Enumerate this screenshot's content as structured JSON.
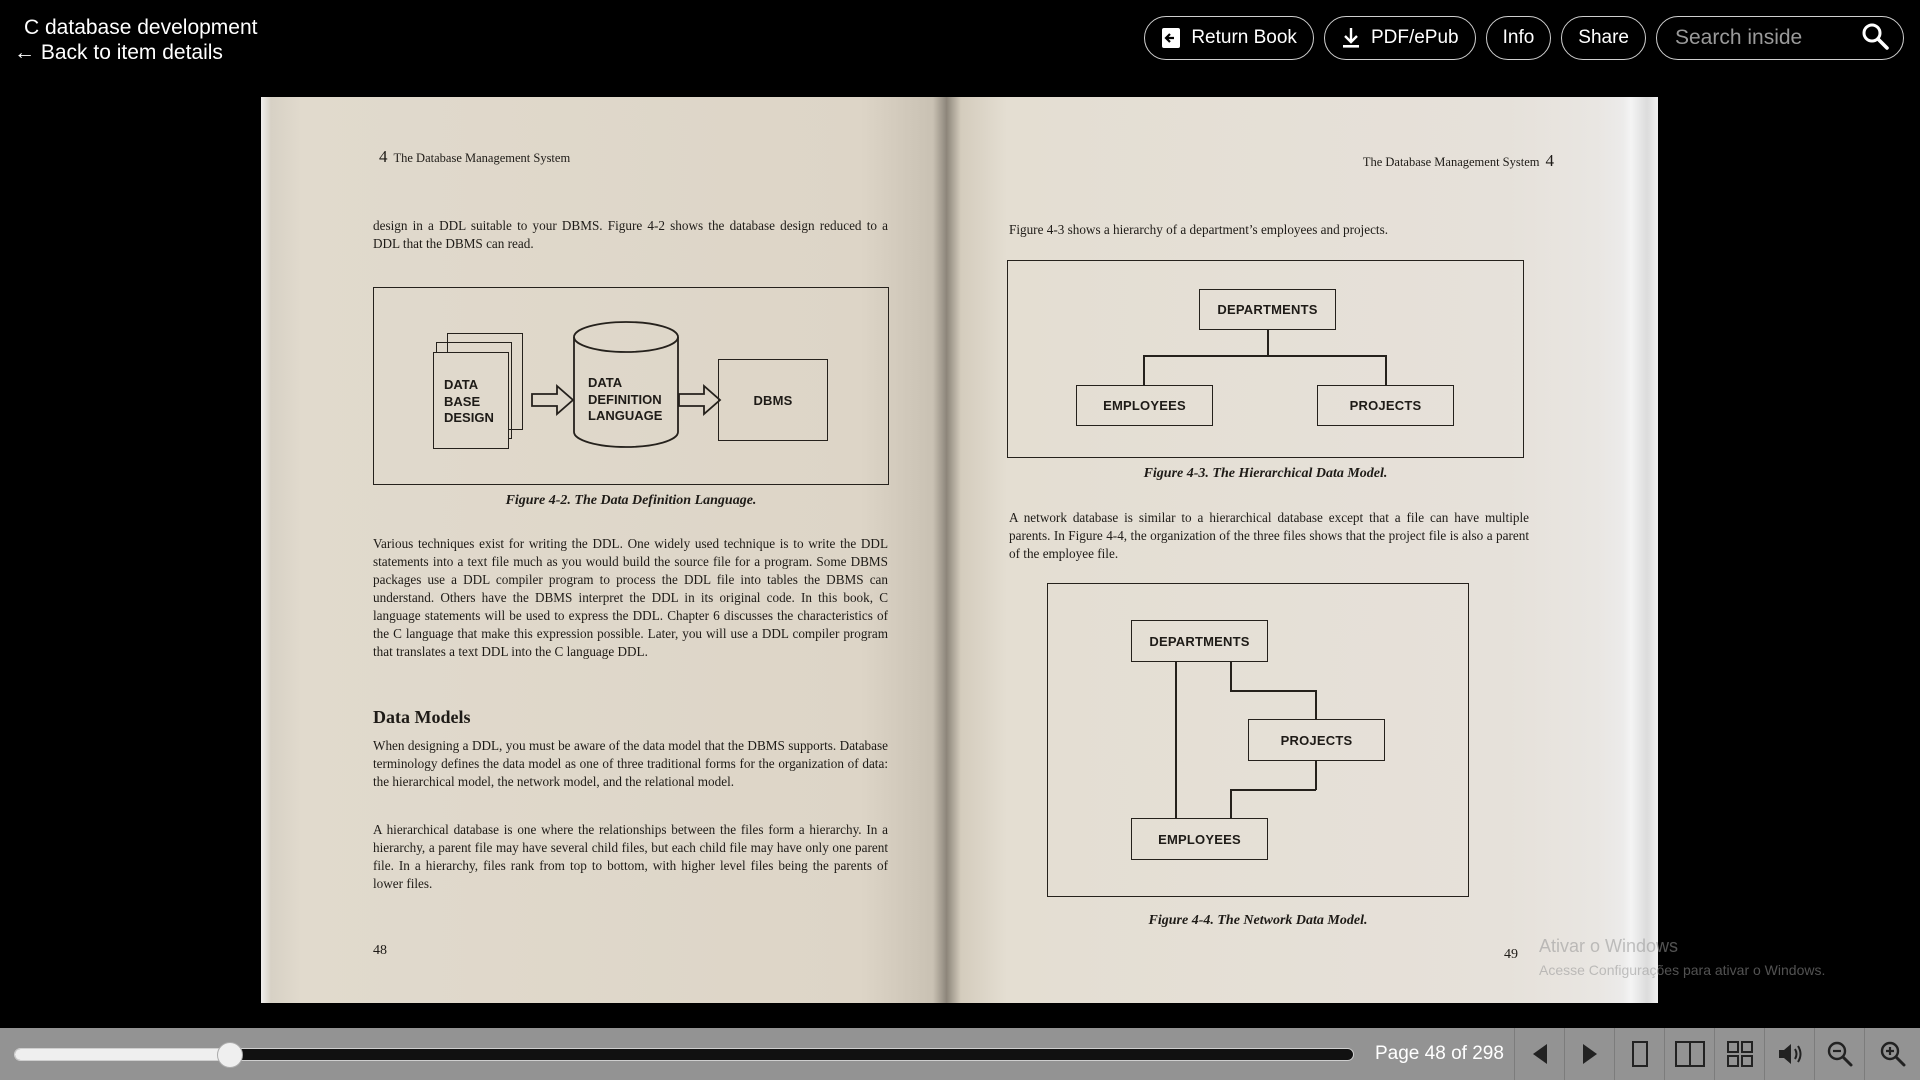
{
  "header": {
    "book_title": "C database development",
    "back_label": "← Back to item details",
    "buttons": {
      "return_book": "Return Book",
      "download": "PDF/ePub",
      "info": "Info",
      "share": "Share"
    },
    "search": {
      "placeholder": "Search inside",
      "value": ""
    }
  },
  "left_page": {
    "running_head_number": "4",
    "running_head_title": "The Database Management System",
    "para1": "design in a DDL suitable to your DBMS. Figure 4-2 shows the database design reduced to a DDL that the DBMS can read.",
    "figure": {
      "db_design": [
        "DATA",
        "BASE",
        "DESIGN"
      ],
      "ddl": [
        "DATA",
        "DEFINITION",
        "LANGUAGE"
      ],
      "dbms": "DBMS",
      "caption": "Figure 4-2.  The Data Definition Language."
    },
    "para2": "Various techniques exist for writing the DDL. One widely used technique is to write the DDL statements into a text file much as you would build the source file for a program. Some DBMS packages use a DDL compiler program to process the DDL file into tables the DBMS can understand. Others have the DBMS interpret the DDL in its original code. In this book, C language statements will be used to express the DDL. Chapter 6 discusses the characteristics of the C language that make this expression possible. Later, you will use a DDL compiler program that translates a text DDL into the C language DDL.",
    "section_heading": "Data Models",
    "para3": "When designing a DDL, you must be aware of the data model that the DBMS supports. Database terminology defines the data model as one of three traditional forms for the organization of data: the hierarchical model, the network model, and the relational model.",
    "para4": "A hierarchical database is one where the relationships between the files form a hierarchy. In a hierarchy, a parent file may have several child files, but each child file may have only one parent file. In a hierarchy, files rank from top to bottom, with higher level files being the parents of lower files.",
    "page_number": "48"
  },
  "right_page": {
    "running_head_title": "The Database Management System",
    "running_head_number": "4",
    "para1": "Figure 4-3 shows a hierarchy of a department’s employees and projects.",
    "figure3": {
      "departments": "DEPARTMENTS",
      "employees": "EMPLOYEES",
      "projects": "PROJECTS",
      "caption": "Figure 4-3.  The Hierarchical Data Model."
    },
    "para2": "A network database is similar to a hierarchical database except that a file can have multiple parents. In Figure 4-4, the organization of the three files shows that the project file is also a parent of the employee file.",
    "figure4": {
      "departments": "DEPARTMENTS",
      "projects": "PROJECTS",
      "employees": "EMPLOYEES",
      "caption": "Figure 4-4.  The Network Data Model."
    },
    "page_number": "49"
  },
  "watermark": {
    "line1": "Ativar o Windows",
    "line2": "Acesse Configurações para ativar o Windows."
  },
  "footer": {
    "page_indicator": "Page 48 of 298",
    "current_page": 48,
    "total_pages": 298,
    "progress_fraction": 0.161,
    "buttons": [
      "previous-page",
      "next-page",
      "one-page-view",
      "two-page-view",
      "thumbnail-view",
      "read-aloud",
      "zoom-out",
      "zoom-in"
    ]
  },
  "colors": {
    "background": "#000000",
    "bottom_bar": "#939393",
    "page_paper": "#e2dccf",
    "ink": "#1e1b17"
  }
}
